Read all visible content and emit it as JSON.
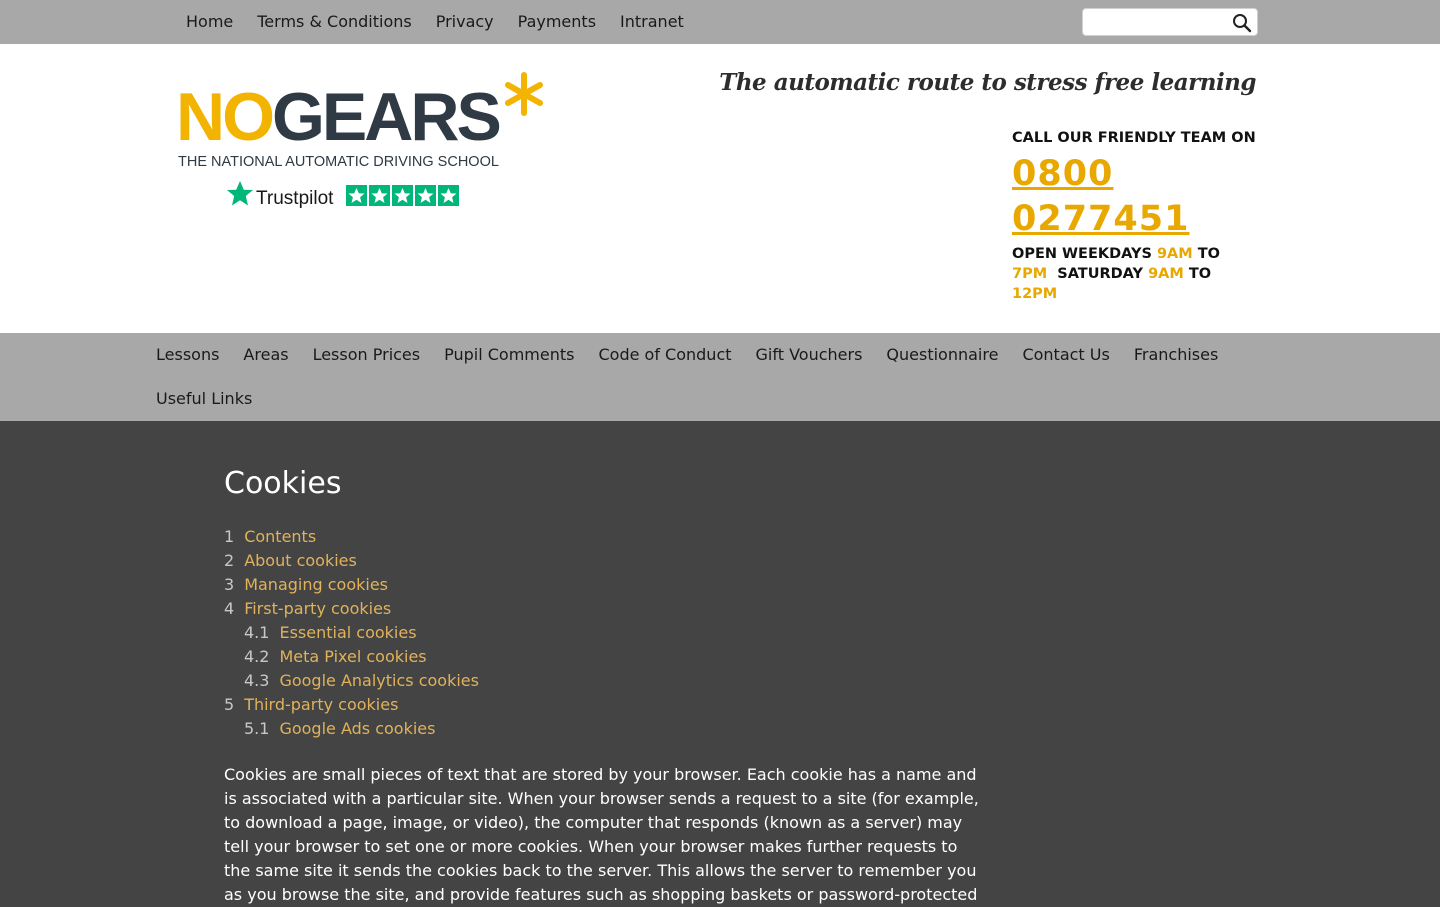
{
  "top_nav": {
    "links": [
      "Home",
      "Terms & Conditions",
      "Privacy",
      "Payments",
      "Intranet"
    ],
    "search": {
      "value": "",
      "placeholder": ""
    }
  },
  "header": {
    "logo_text_no": "NO",
    "logo_text_gears": "GEARS",
    "logo_subtitle": "THE NATIONAL AUTOMATIC DRIVING SCHOOL",
    "trustpilot_text": "Trustpilot",
    "tagline": "The automatic route to stress free learning",
    "contact": {
      "call": "CALL OUR FRIENDLY TEAM ON",
      "phone": "0800 0277451",
      "open_weekdays": "OPEN WEEKDAYS",
      "wd_from": "9AM",
      "to1": "TO",
      "wd_to": "7PM",
      "saturday": "SATURDAY",
      "sat_from": "9AM",
      "to2": "TO",
      "sat_to": "12PM"
    }
  },
  "main_nav": {
    "row1": [
      "Lessons",
      "Areas",
      "Lesson Prices",
      "Pupil Comments",
      "Code of Conduct",
      "Gift Vouchers",
      "Questionnaire",
      "Contact Us",
      "Franchises"
    ],
    "row2": [
      "Useful Links"
    ]
  },
  "content": {
    "title": "Cookies",
    "toc": [
      {
        "num": "1",
        "label": "Contents"
      },
      {
        "num": "2",
        "label": "About cookies"
      },
      {
        "num": "3",
        "label": "Managing cookies"
      },
      {
        "num": "4",
        "label": "First-party cookies"
      },
      {
        "num": "4.1",
        "label": "Essential cookies"
      },
      {
        "num": "4.2",
        "label": "Meta Pixel cookies"
      },
      {
        "num": "4.3",
        "label": "Google Analytics cookies"
      },
      {
        "num": "5",
        "label": "Third-party cookies"
      },
      {
        "num": "5.1",
        "label": "Google Ads cookies"
      }
    ],
    "intro": "Cookies are small pieces of text that are stored by your browser. Each cookie has a name and is associated with a particular site. When your browser sends a request to a site (for example, to download a page, image, or video), the computer that responds (known as a server) may tell your browser to set one or more cookies. When your browser makes further requests to the same site it sends the cookies back to the server. This allows the server to remember you as you browse the site, and provide features such as shopping baskets or password-protected"
  },
  "colors": {
    "accent": "#e8a800",
    "link": "#e0b25a",
    "nav_bg": "#a8a8a8",
    "content_bg": "#444444"
  },
  "icons": [
    "search-icon",
    "asterisk-logo-icon",
    "trustpilot-star-icon",
    "trustpilot-rating-icon"
  ]
}
